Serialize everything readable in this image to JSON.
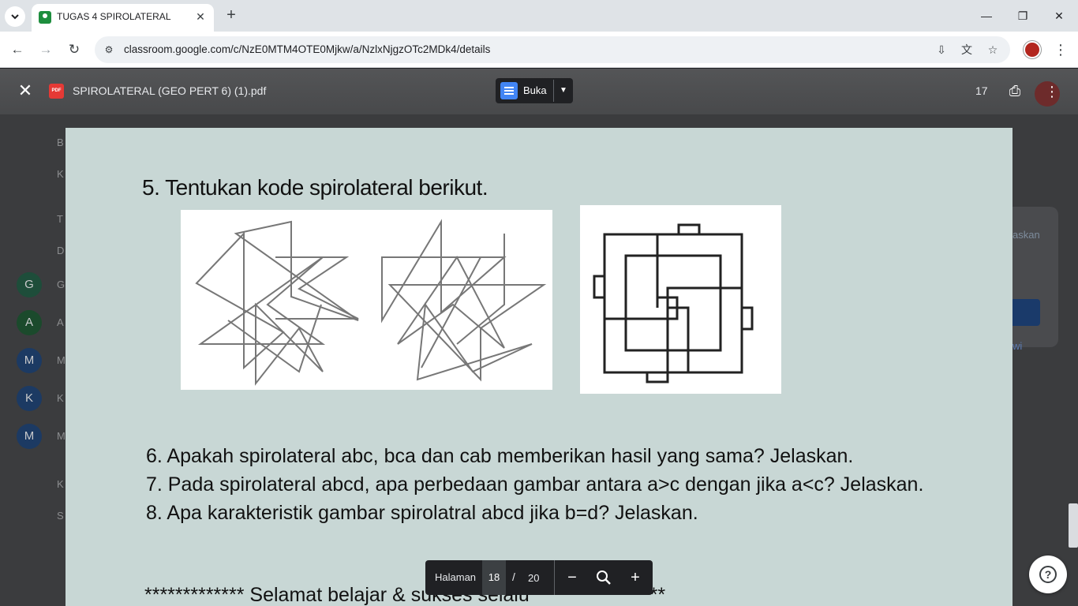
{
  "browser": {
    "tab_title": "TUGAS 4 SPIROLATERAL",
    "tab_close": "✕",
    "new_tab": "+",
    "url": "classroom.google.com/c/NzE0MTM4OTE0Mjkw/a/NzlxNjgzOTc2MDk4/details",
    "window_controls": [
      "—",
      "❐",
      "✕"
    ]
  },
  "classroom_bg": {
    "sidebar_avatars": [
      {
        "letter": "G",
        "color": "#1e4d3a"
      },
      {
        "letter": "A",
        "color": "#1b4a2c"
      },
      {
        "letter": "M",
        "color": "#1c3a63"
      },
      {
        "letter": "K",
        "color": "#1c3a63"
      },
      {
        "letter": "M",
        "color": "#1c3a63"
      }
    ],
    "sidebar_letters": [
      "B",
      "K",
      "T",
      "D",
      "G",
      "A",
      "M",
      "K",
      "M",
      "K",
      "S"
    ],
    "right_snippets": [
      "askan",
      "wi"
    ]
  },
  "viewer": {
    "close_icon": "✕",
    "pdf_badge": "PDF",
    "file_name": "SPIROLATERAL (GEO PERT 6) (1).pdf",
    "open_button": "Buka",
    "header_count": "17"
  },
  "page": {
    "question5": "5. Tentukan kode spirolateral berikut.",
    "questions": [
      "6. Apakah spirolateral abc, bca dan cab memberikan hasil yang sama? Jelaskan.",
      "7. Pada spirolateral abcd, apa perbedaan gambar antara a>c dengan jika a<c? Jelaskan.",
      "8. Apa karakteristik gambar spirolatral abcd jika b=d? Jelaskan."
    ],
    "footer": "************* Selamat belajar & sukses selalu *****************"
  },
  "page_controls": {
    "label": "Halaman",
    "current": "18",
    "slash": "/",
    "total": "20"
  },
  "help": "?"
}
